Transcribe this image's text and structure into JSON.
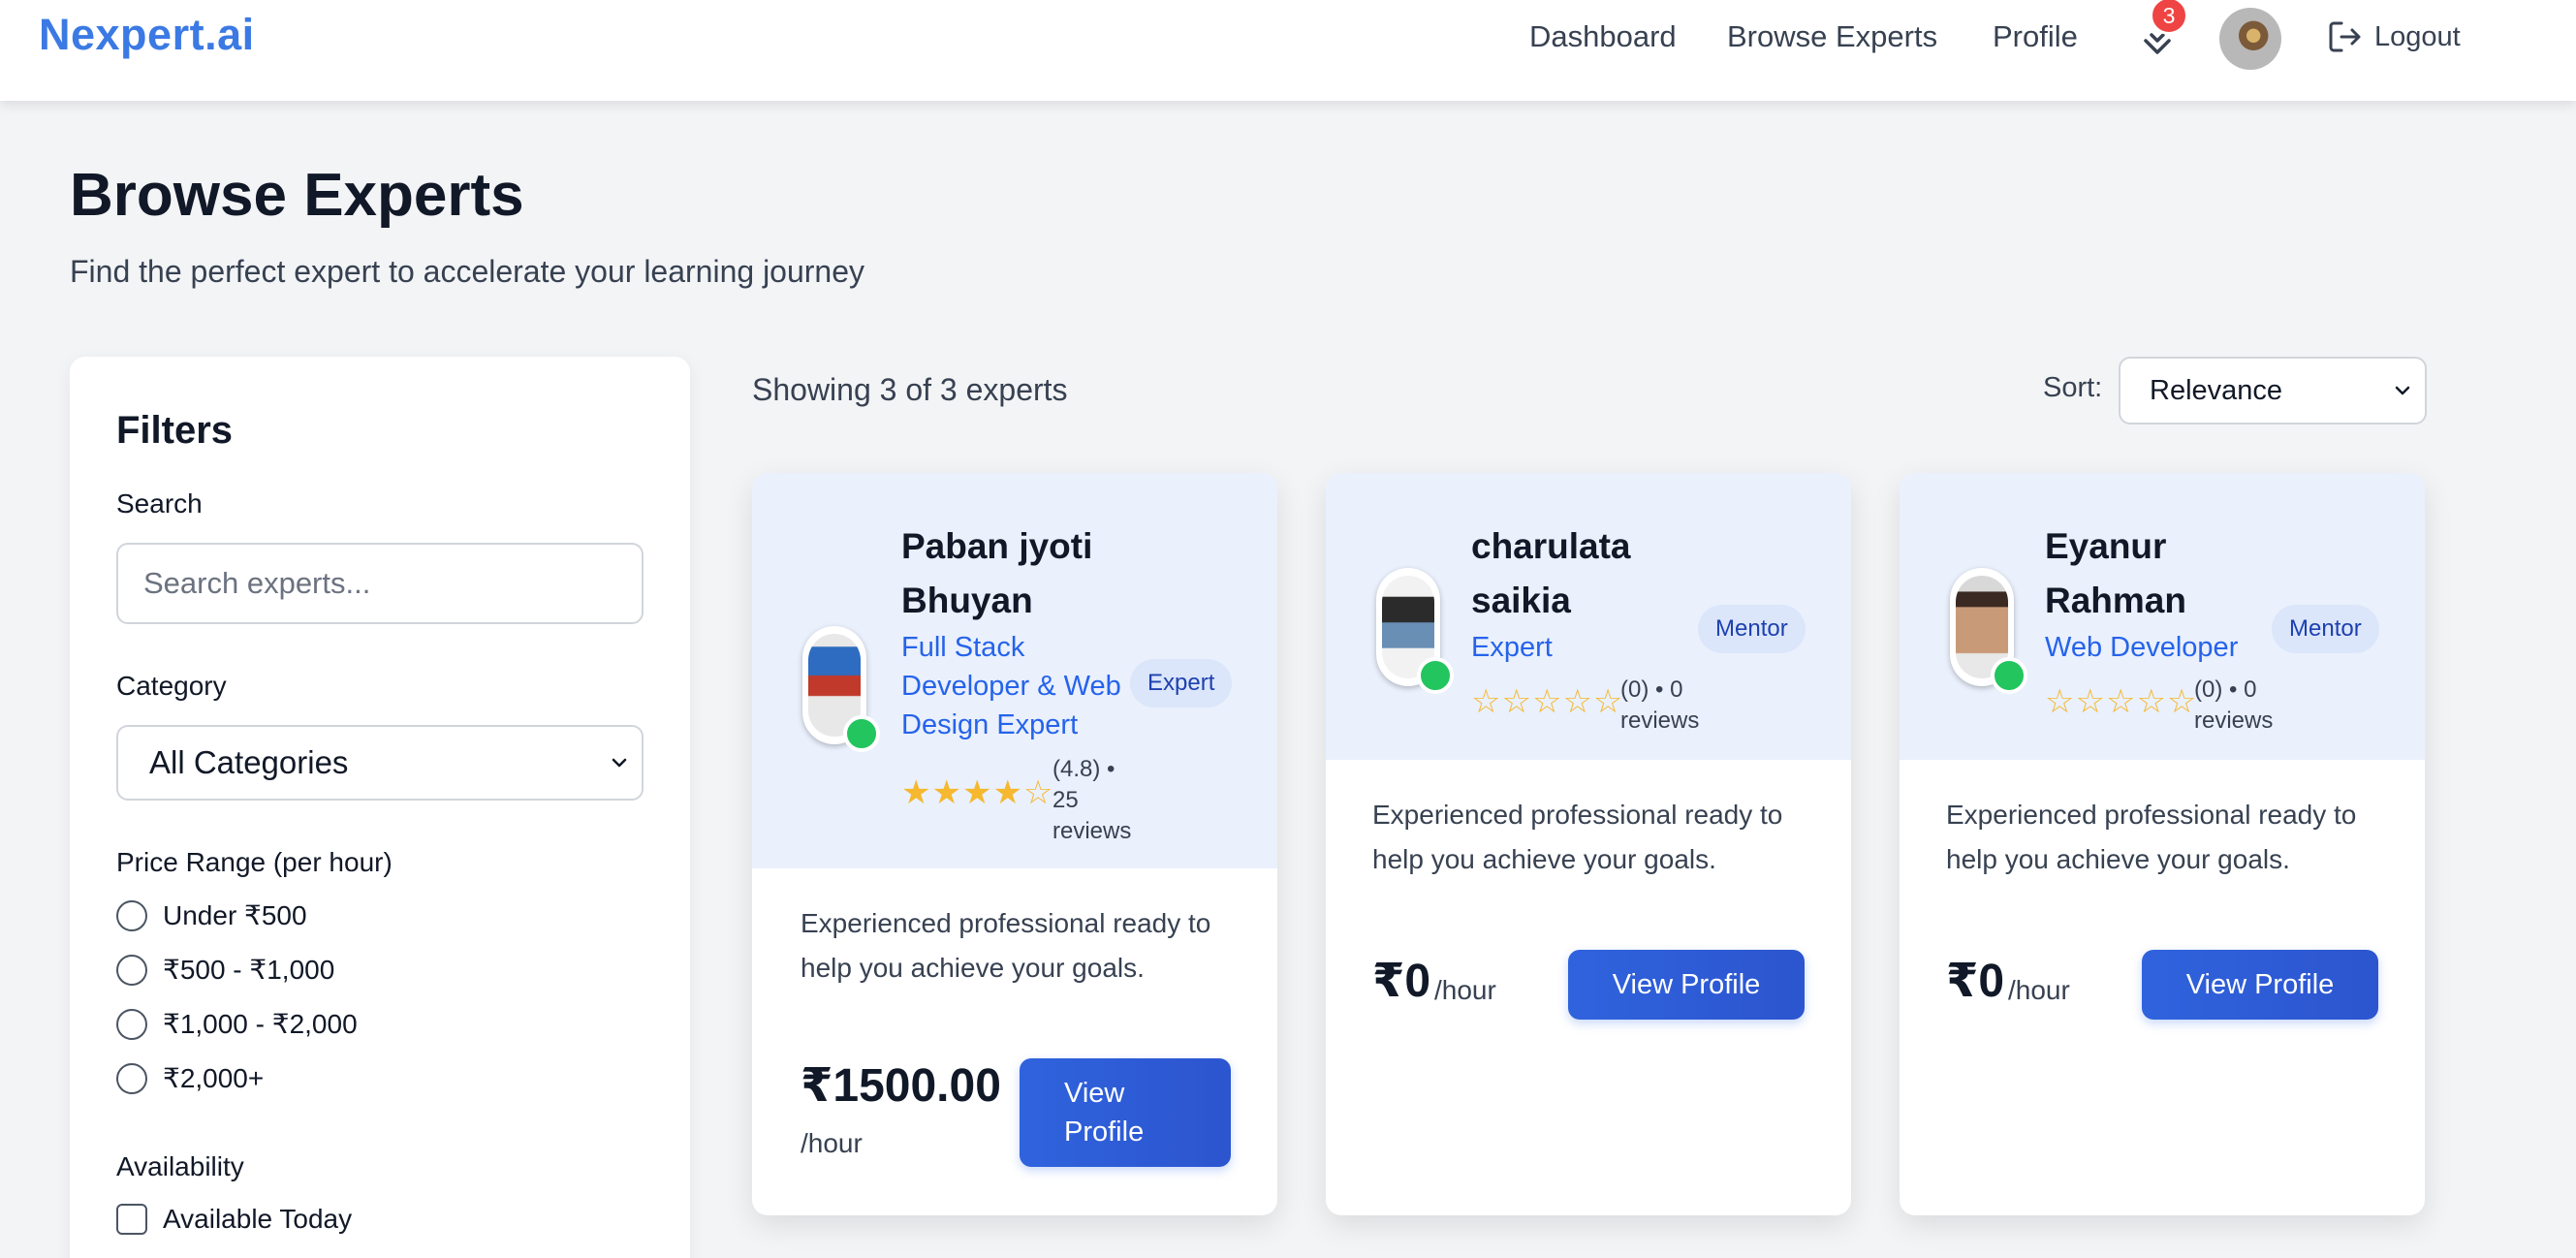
{
  "nav": {
    "brand": "Nexpert.ai",
    "links": [
      "Dashboard",
      "Browse Experts",
      "Profile"
    ],
    "notification_count": "3",
    "logout_label": "Logout"
  },
  "page": {
    "title": "Browse Experts",
    "subtitle": "Find the perfect expert to accelerate your learning journey"
  },
  "filters": {
    "title": "Filters",
    "search_label": "Search",
    "search_placeholder": "Search experts...",
    "category_label": "Category",
    "category_value": "All Categories",
    "price_label": "Price Range (per hour)",
    "price_options": [
      "Under ₹500",
      "₹500 - ₹1,000",
      "₹1,000 - ₹2,000",
      "₹2,000+"
    ],
    "availability_label": "Availability",
    "availability_option": "Available Today"
  },
  "results": {
    "count_text": "Showing 3 of 3 experts",
    "sort_label": "Sort:",
    "sort_value": "Relevance"
  },
  "experts": [
    {
      "name_line1": "Paban jyoti",
      "name_line2": "Bhuyan",
      "title_line1": "Full Stack",
      "title_line2": "Developer & Web",
      "title_line3": "Design Expert",
      "badge": "Expert",
      "stars": "★★★★☆",
      "rating_line1": "(4.8) •",
      "rating_line2": "25",
      "rating_line3": "reviews",
      "desc_line1": "Experienced professional ready to",
      "desc_line2": "help you achieve your goals.",
      "price": "₹1500.00",
      "per_hour": "/hour",
      "button_line1": "View",
      "button_line2": "Profile",
      "online_color": "#22c55e"
    },
    {
      "name_line1": "charulata",
      "name_line2": "saikia",
      "title": "Expert",
      "badge": "Mentor",
      "stars": "☆☆☆☆☆",
      "rating_line1": "(0) • 0",
      "rating_line2": "reviews",
      "desc_line1": "Experienced professional ready to",
      "desc_line2": "help you achieve your goals.",
      "price": "₹0",
      "per_hour": "/hour",
      "button": "View Profile",
      "online_color": "#22c55e"
    },
    {
      "name_line1": "Eyanur",
      "name_line2": "Rahman",
      "title": "Web Developer",
      "badge": "Mentor",
      "stars": "☆☆☆☆☆",
      "rating_line1": "(0) • 0",
      "rating_line2": "reviews",
      "desc_line1": "Experienced professional ready to",
      "desc_line2": "help you achieve your goals.",
      "price": "₹0",
      "per_hour": "/hour",
      "button": "View Profile",
      "online_color": "#22c55e"
    }
  ],
  "colors": {
    "brand": "#3b7ae4",
    "primary_button": "#2c5bd6",
    "card_header": "#eaf0fc",
    "badge_bg": "#dbe6fa",
    "notification": "#ef4444",
    "star": "#f5b82e"
  },
  "icons": [
    "bell-notification-icon",
    "logout-icon",
    "chevron-down-icon",
    "online-status-icon"
  ]
}
